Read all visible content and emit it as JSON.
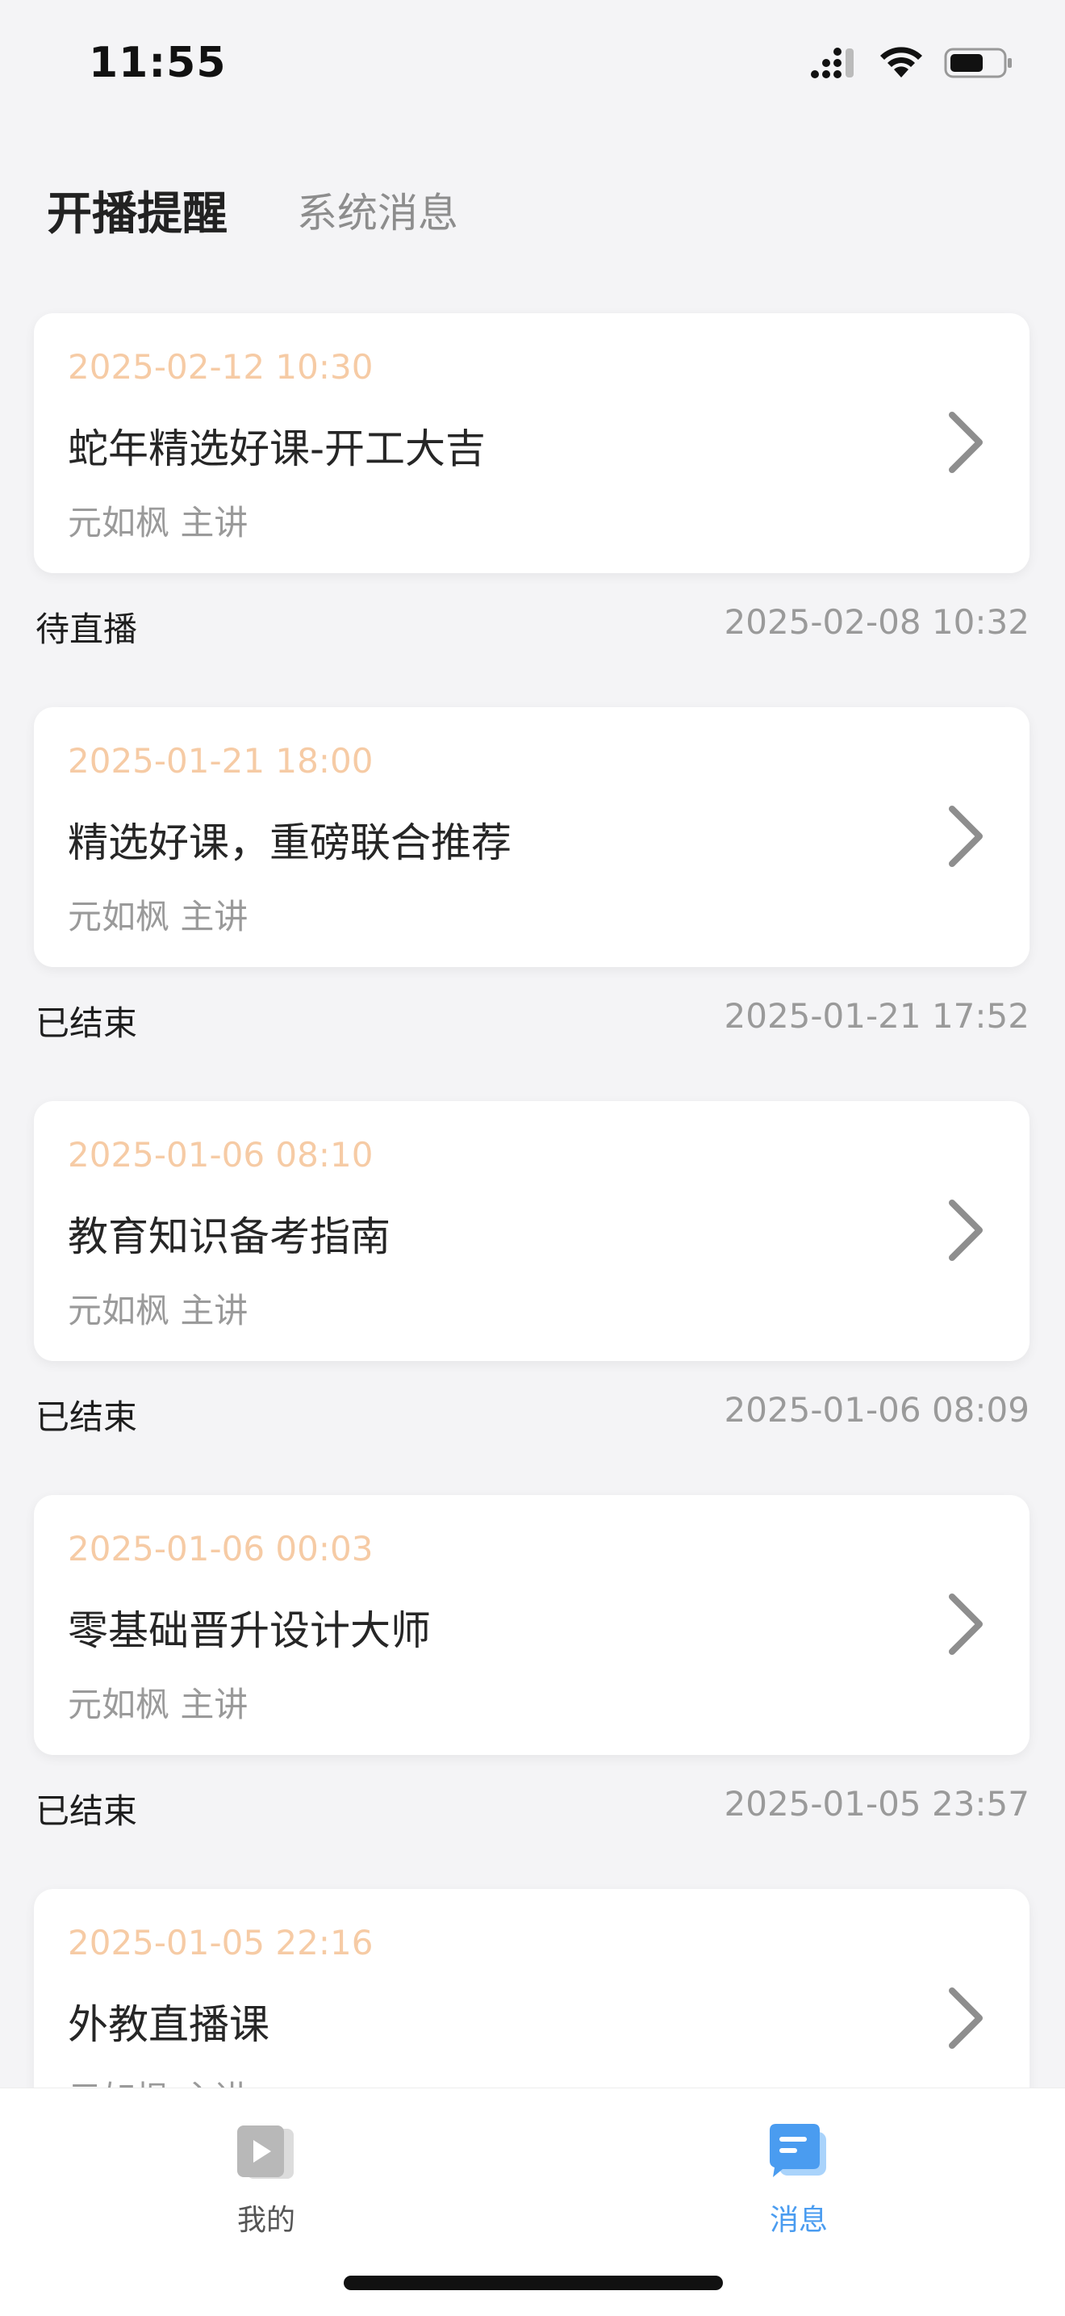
{
  "status_bar": {
    "time": "11:55",
    "icons": [
      "cellular-signal-icon",
      "wifi-icon",
      "battery-icon"
    ]
  },
  "header": {
    "tabs": [
      {
        "label": "开播提醒",
        "active": true
      },
      {
        "label": "系统消息",
        "active": false
      }
    ]
  },
  "list": {
    "items": [
      {
        "start_time": "2025-02-12 10:30",
        "title": "蛇年精选好课-开工大吉",
        "speaker": "元如枫 主讲",
        "status": "待直播",
        "created_at": "2025-02-08 10:32"
      },
      {
        "start_time": "2025-01-21 18:00",
        "title": "精选好课，重磅联合推荐",
        "speaker": "元如枫 主讲",
        "status": "已结束",
        "created_at": "2025-01-21 17:52"
      },
      {
        "start_time": "2025-01-06 08:10",
        "title": "教育知识备考指南",
        "speaker": "元如枫 主讲",
        "status": "已结束",
        "created_at": "2025-01-06 08:09"
      },
      {
        "start_time": "2025-01-06 00:03",
        "title": "零基础晋升设计大师",
        "speaker": "元如枫 主讲",
        "status": "已结束",
        "created_at": "2025-01-05 23:57"
      },
      {
        "start_time": "2025-01-05 22:16",
        "title": "外教直播课",
        "speaker": "元如枫 主讲",
        "status": "",
        "created_at": ""
      }
    ]
  },
  "tab_bar": {
    "items": [
      {
        "label": "我的",
        "icon": "play-video-icon",
        "active": false
      },
      {
        "label": "消息",
        "icon": "message-icon",
        "active": true
      }
    ]
  },
  "colors": {
    "accent": "#4a9cf0",
    "time_highlight": "#f6cba5",
    "background": "#f4f4f6"
  }
}
